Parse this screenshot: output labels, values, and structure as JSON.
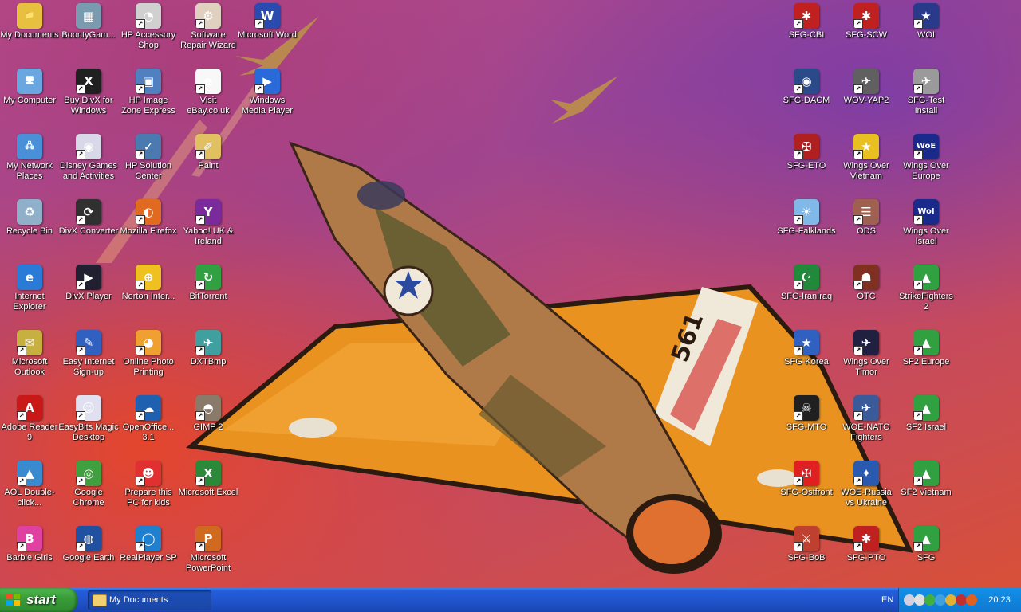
{
  "desktop": {
    "icons": [
      {
        "label": "My Documents",
        "icon": "folder-documents-icon",
        "color": "#e8c040",
        "glyph": "📁",
        "shortcut": false
      },
      {
        "label": "My Computer",
        "icon": "computer-icon",
        "color": "#6aa6e0",
        "glyph": "🖥",
        "shortcut": false
      },
      {
        "label": "My Network Places",
        "icon": "network-icon",
        "color": "#4a90d8",
        "glyph": "🖧",
        "shortcut": false
      },
      {
        "label": "Recycle Bin",
        "icon": "recycle-bin-icon",
        "color": "#8fb0c8",
        "glyph": "♻",
        "shortcut": false
      },
      {
        "label": "Internet Explorer",
        "icon": "internet-explorer-icon",
        "color": "#2a7ad8",
        "glyph": "e",
        "shortcut": false
      },
      {
        "label": "Microsoft Outlook",
        "icon": "outlook-icon",
        "color": "#c8b040",
        "glyph": "✉",
        "shortcut": true
      },
      {
        "label": "Adobe Reader 9",
        "icon": "adobe-reader-icon",
        "color": "#c81818",
        "glyph": "A",
        "shortcut": true
      },
      {
        "label": "AOL Double-click...",
        "icon": "aol-icon",
        "color": "#3a8ad0",
        "glyph": "▲",
        "shortcut": true
      },
      {
        "label": "Barbie Girls",
        "icon": "barbie-girls-icon",
        "color": "#e040a0",
        "glyph": "B",
        "shortcut": true
      },
      {
        "label": "BoontyGam...",
        "icon": "boonty-games-icon",
        "color": "#7a9ab0",
        "glyph": "▦",
        "shortcut": false
      },
      {
        "label": "Buy DivX for Windows",
        "icon": "divx-icon",
        "color": "#202020",
        "glyph": "X",
        "shortcut": true
      },
      {
        "label": "Disney Games and Activities",
        "icon": "disney-icon",
        "color": "#d8d8e8",
        "glyph": "◉",
        "shortcut": true
      },
      {
        "label": "DivX Converter",
        "icon": "divx-converter-icon",
        "color": "#303030",
        "glyph": "⟳",
        "shortcut": true
      },
      {
        "label": "DivX Player",
        "icon": "divx-player-icon",
        "color": "#202030",
        "glyph": "▶",
        "shortcut": true
      },
      {
        "label": "Easy Internet Sign-up",
        "icon": "internet-signup-icon",
        "color": "#3060c0",
        "glyph": "✎",
        "shortcut": true
      },
      {
        "label": "EasyBits Magic Desktop",
        "icon": "easybits-icon",
        "color": "#e0e0f0",
        "glyph": "☺",
        "shortcut": true
      },
      {
        "label": "Google Chrome",
        "icon": "chrome-icon",
        "color": "#40a040",
        "glyph": "◎",
        "shortcut": true
      },
      {
        "label": "Google Earth",
        "icon": "google-earth-icon",
        "color": "#2050a0",
        "glyph": "◍",
        "shortcut": true
      },
      {
        "label": "HP Accessory Shop",
        "icon": "hp-accessory-icon",
        "color": "#d0d0d0",
        "glyph": "◔",
        "shortcut": true
      },
      {
        "label": "HP Image Zone Express",
        "icon": "hp-image-zone-icon",
        "color": "#5080c0",
        "glyph": "▣",
        "shortcut": true
      },
      {
        "label": "HP Solution Center",
        "icon": "hp-solution-icon",
        "color": "#4a7ab0",
        "glyph": "✓",
        "shortcut": true
      },
      {
        "label": "Mozilla Firefox",
        "icon": "firefox-icon",
        "color": "#e06a20",
        "glyph": "◐",
        "shortcut": true
      },
      {
        "label": "Norton Inter...",
        "icon": "norton-icon",
        "color": "#f0c020",
        "glyph": "⊕",
        "shortcut": true
      },
      {
        "label": "Online Photo Printing",
        "icon": "photo-printing-icon",
        "color": "#f0a030",
        "glyph": "◕",
        "shortcut": true
      },
      {
        "label": "OpenOffice... 3.1",
        "icon": "openoffice-icon",
        "color": "#2060b0",
        "glyph": "☁",
        "shortcut": true
      },
      {
        "label": "Prepare this PC for kids",
        "icon": "kids-pc-icon",
        "color": "#e03030",
        "glyph": "☻",
        "shortcut": true
      },
      {
        "label": "RealPlayer SP",
        "icon": "realplayer-icon",
        "color": "#2080d0",
        "glyph": "◯",
        "shortcut": true
      },
      {
        "label": "Software Repair Wizard",
        "icon": "repair-wizard-icon",
        "color": "#e0d0c0",
        "glyph": "⚙",
        "shortcut": true
      },
      {
        "label": "Visit eBay.co.uk",
        "icon": "ebay-icon",
        "color": "#f8f8f8",
        "glyph": "e",
        "shortcut": true
      },
      {
        "label": "Paint",
        "icon": "paint-icon",
        "color": "#e0c060",
        "glyph": "✐",
        "shortcut": true
      },
      {
        "label": "Yahoo! UK & Ireland",
        "icon": "yahoo-icon",
        "color": "#7a2a9a",
        "glyph": "Y",
        "shortcut": true
      },
      {
        "label": "BitTorrent",
        "icon": "bittorrent-icon",
        "color": "#30a040",
        "glyph": "↻",
        "shortcut": true
      },
      {
        "label": "DXTBmp",
        "icon": "dxtbmp-icon",
        "color": "#40a0a0",
        "glyph": "✈",
        "shortcut": true
      },
      {
        "label": "GIMP 2",
        "icon": "gimp-icon",
        "color": "#8a7a6a",
        "glyph": "◓",
        "shortcut": true
      },
      {
        "label": "Microsoft Excel",
        "icon": "excel-icon",
        "color": "#2a8a3a",
        "glyph": "X",
        "shortcut": true
      },
      {
        "label": "Microsoft PowerPoint",
        "icon": "powerpoint-icon",
        "color": "#d06a20",
        "glyph": "P",
        "shortcut": true
      },
      {
        "label": "Microsoft Word",
        "icon": "word-icon",
        "color": "#2a4ab0",
        "glyph": "W",
        "shortcut": true
      },
      {
        "label": "Windows Media Player",
        "icon": "media-player-icon",
        "color": "#2a6ad8",
        "glyph": "▶",
        "shortcut": true
      }
    ],
    "right_icons": [
      {
        "label": "SFG-CBI",
        "icon": "flag-usa-japan-icon",
        "color": "#c02020",
        "glyph": "✱",
        "shortcut": true
      },
      {
        "label": "SFG-DACM",
        "icon": "sfg-dacm-icon",
        "color": "#2a4a8a",
        "glyph": "◉",
        "shortcut": true
      },
      {
        "label": "SFG-ETO",
        "icon": "flag-uk-germany-icon",
        "color": "#b02020",
        "glyph": "✠",
        "shortcut": true
      },
      {
        "label": "SFG-Falklands",
        "icon": "flag-argentina-icon",
        "color": "#80b8e8",
        "glyph": "☀",
        "shortcut": true
      },
      {
        "label": "SFG-IranIraq",
        "icon": "flag-iran-iraq-icon",
        "color": "#208a3a",
        "glyph": "☪",
        "shortcut": true
      },
      {
        "label": "SFG-Korea",
        "icon": "flag-korea-icon",
        "color": "#3060c0",
        "glyph": "★",
        "shortcut": true
      },
      {
        "label": "SFG-MTO",
        "icon": "sfg-mto-icon",
        "color": "#202020",
        "glyph": "☠",
        "shortcut": true
      },
      {
        "label": "SFG-Ostfront",
        "icon": "flag-red-icon",
        "color": "#e02020",
        "glyph": "✠",
        "shortcut": true
      },
      {
        "label": "SFG-BoB",
        "icon": "sfg-bob-icon",
        "color": "#c04030",
        "glyph": "⚔",
        "shortcut": true
      },
      {
        "label": "SFG-SCW",
        "icon": "sfg-scw-icon",
        "color": "#c02020",
        "glyph": "✱",
        "shortcut": true
      },
      {
        "label": "WOV-YAP2",
        "icon": "wov-yap2-icon",
        "color": "#606060",
        "glyph": "✈",
        "shortcut": true
      },
      {
        "label": "Wings Over Vietnam",
        "icon": "flag-vietnam-icon",
        "color": "#e8c020",
        "glyph": "★",
        "shortcut": true
      },
      {
        "label": "ODS",
        "icon": "ods-icon",
        "color": "#a06050",
        "glyph": "☰",
        "shortcut": true
      },
      {
        "label": "OTC",
        "icon": "otc-icon",
        "color": "#803020",
        "glyph": "☗",
        "shortcut": true
      },
      {
        "label": "Wings Over Timor",
        "icon": "wings-timor-icon",
        "color": "#202040",
        "glyph": "✈",
        "shortcut": true
      },
      {
        "label": "WOE-NATO Fighters",
        "icon": "woe-nato-icon",
        "color": "#3a5a9a",
        "glyph": "✈",
        "shortcut": true
      },
      {
        "label": "WOE-Russia vs Ukraine",
        "icon": "flag-ukraine-icon",
        "color": "#2a5ab0",
        "glyph": "✦",
        "shortcut": true
      },
      {
        "label": "SFG-PTO",
        "icon": "flag-usa-japan-icon",
        "color": "#c02020",
        "glyph": "✱",
        "shortcut": true
      },
      {
        "label": "WOI",
        "icon": "woi-icon",
        "color": "#2a3a8a",
        "glyph": "★",
        "shortcut": true
      },
      {
        "label": "SFG-Test Install",
        "icon": "test-install-icon",
        "color": "#9a9a9a",
        "glyph": "✈",
        "shortcut": true
      },
      {
        "label": "Wings Over Europe",
        "icon": "woe-icon",
        "color": "#1a2a8a",
        "glyph": "WoE",
        "shortcut": true
      },
      {
        "label": "Wings Over Israel",
        "icon": "woi-logo-icon",
        "color": "#1a2a8a",
        "glyph": "WoI",
        "shortcut": true
      },
      {
        "label": "StrikeFighters 2",
        "icon": "strikefighters2-icon",
        "color": "#30a040",
        "glyph": "▲",
        "shortcut": true
      },
      {
        "label": "SF2 Europe",
        "icon": "sf2-europe-icon",
        "color": "#30a040",
        "glyph": "▲",
        "shortcut": true
      },
      {
        "label": "SF2 Israel",
        "icon": "sf2-israel-icon",
        "color": "#30a040",
        "glyph": "▲",
        "shortcut": true
      },
      {
        "label": "SF2 Vietnam",
        "icon": "sf2-vietnam-icon",
        "color": "#30a040",
        "glyph": "▲",
        "shortcut": true
      },
      {
        "label": "SFG",
        "icon": "sfg-icon",
        "color": "#30a040",
        "glyph": "▲",
        "shortcut": true
      }
    ]
  },
  "taskbar": {
    "start_label": "start",
    "window_button": "My Documents",
    "language": "EN",
    "tray_icons": [
      {
        "icon": "back-icon",
        "color": "#d0d0e0"
      },
      {
        "icon": "network-x-icon",
        "color": "#e0e0e0"
      },
      {
        "icon": "antivirus-icon",
        "color": "#40b040"
      },
      {
        "icon": "safely-remove-icon",
        "color": "#40a0e0"
      },
      {
        "icon": "update-icon",
        "color": "#e0b030"
      },
      {
        "icon": "security-icon",
        "color": "#c03030"
      },
      {
        "icon": "display-icon",
        "color": "#e06020"
      }
    ],
    "clock": "20:23",
    "start_color": "#3a9d3a"
  },
  "wallpaper": {
    "aircraft_marking": "561"
  }
}
